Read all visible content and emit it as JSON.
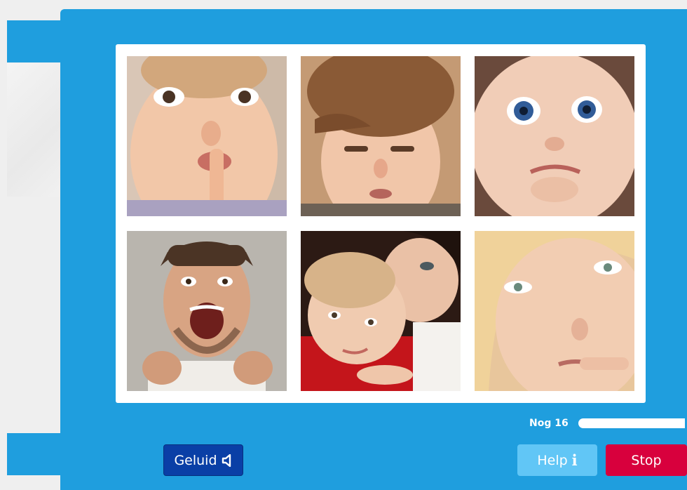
{
  "photos": [
    {
      "name": "photo-toddler-finger-on-lip",
      "description": "child-thinking"
    },
    {
      "name": "photo-boy-frowning",
      "description": "child-sad"
    },
    {
      "name": "photo-baby-wide-eyes",
      "description": "baby-scared"
    },
    {
      "name": "photo-man-shouting",
      "description": "man-angry"
    },
    {
      "name": "photo-child-hugging-mother",
      "description": "child-comforted"
    },
    {
      "name": "photo-woman-biting-finger",
      "description": "woman-worried"
    }
  ],
  "progress": {
    "label": "Nog 16",
    "remaining": 16,
    "fill_fraction": 0.98
  },
  "buttons": {
    "sound_label": "Geluid",
    "sound_icon": "speaker-icon",
    "help_label": "Help",
    "help_icon": "info-icon",
    "help_icon_glyph": "i",
    "stop_label": "Stop"
  },
  "colors": {
    "modal": "#1f9ede",
    "sound_button": "#0a3fa6",
    "help_button": "#61c6f6",
    "stop_button": "#d8003d"
  }
}
